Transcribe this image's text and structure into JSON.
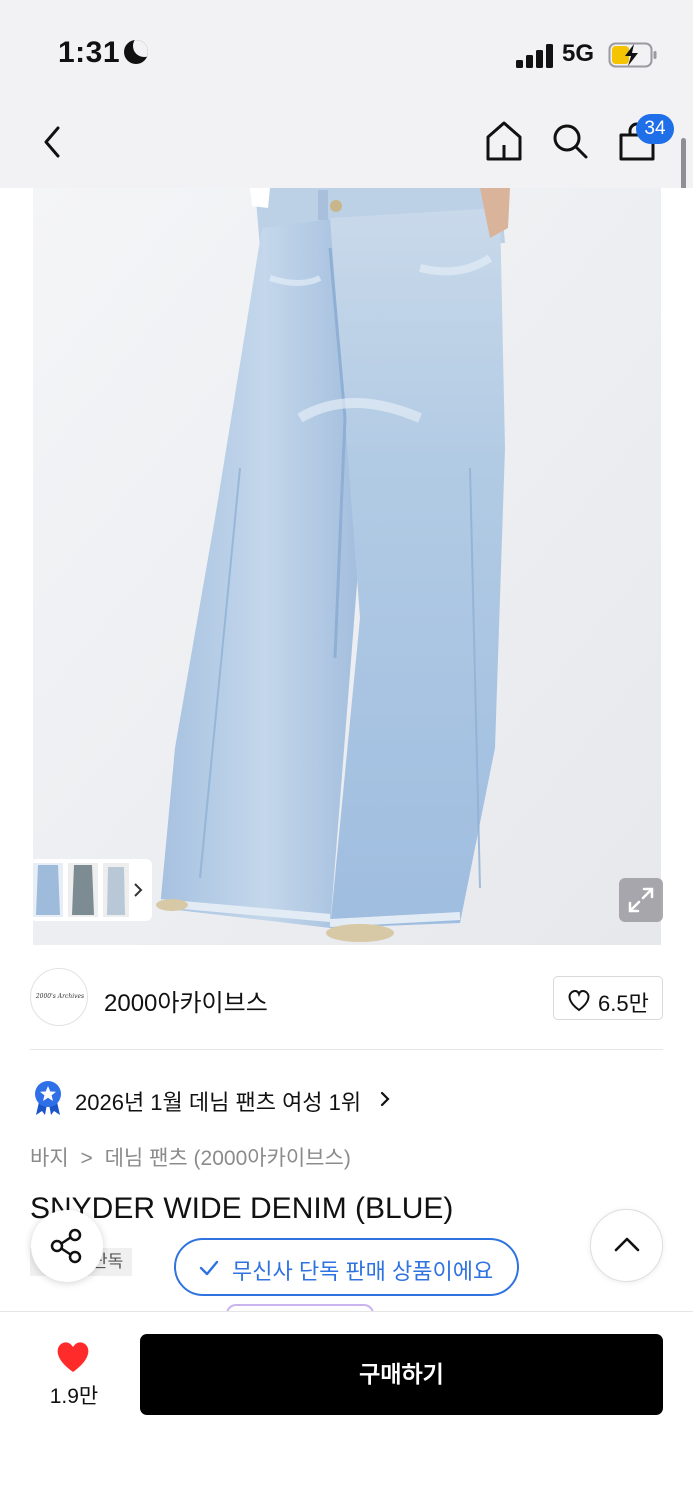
{
  "status_bar": {
    "time": "1:31",
    "network": "5G",
    "icons": [
      "moon-icon",
      "signal-icon",
      "battery-charging-icon"
    ]
  },
  "nav": {
    "icons": [
      "back-chevron-icon",
      "home-icon",
      "search-icon",
      "shopping-bag-icon"
    ],
    "cart_count": "34"
  },
  "product": {
    "image_alt": "Light blue wide-leg denim jeans",
    "brand_logo_text": "2000's Archives",
    "seller_name": "2000아카이브스",
    "likes": "6.5만",
    "ranking": "2026년 1월 데님 팬츠 여성 1위",
    "breadcrumb": [
      "바지",
      "데님 팬츠 (2000아카이브스)"
    ],
    "title": "SNYDER WIDE DENIM (BLUE)",
    "tag": "단독",
    "exclusive_badge": "무신사 단독 판매 상품이에요"
  },
  "bottom_bar": {
    "wishlist_count": "1.9만",
    "buy_label": "구매하기"
  },
  "colors": {
    "accent_blue": "#2f73e0",
    "badge_blue": "#1f6fe8",
    "heart_red": "#ff2a2a",
    "denim": "#a9c4e0"
  }
}
